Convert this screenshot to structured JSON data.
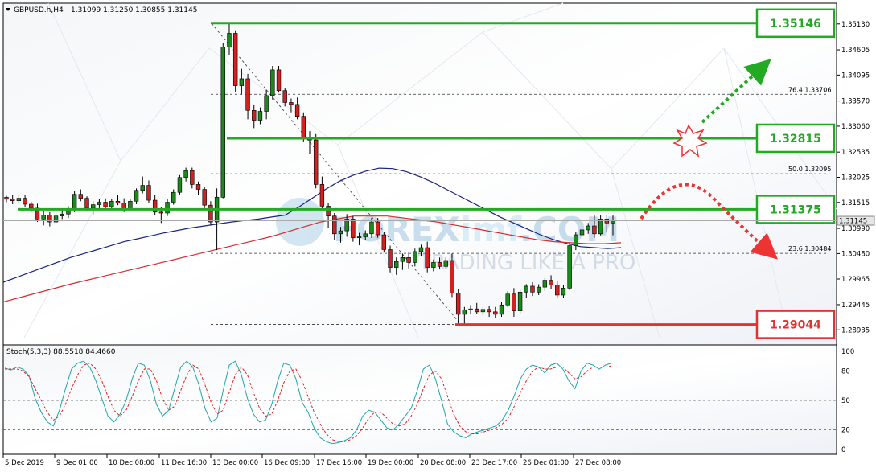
{
  "header": {
    "symbol": "GBPUSD.h,H4",
    "ohlc": "1.31099 1.31250 1.30855 1.31145"
  },
  "chart_data": {
    "type": "candlestick",
    "symbol": "GBPUSD.h",
    "timeframe": "H4",
    "price_axis": {
      "ticks": [
        "1.35130",
        "1.34605",
        "1.34095",
        "1.33570",
        "1.33060",
        "1.32535",
        "1.32025",
        "1.31515",
        "1.30990",
        "1.30480",
        "1.29965",
        "1.29445",
        "1.28935"
      ],
      "ylim": [
        1.2863,
        1.3555
      ]
    },
    "current_price": "1.31145",
    "time_axis": [
      "5 Dec 2019",
      "9 Dec 01:00",
      "10 Dec 08:00",
      "11 Dec 16:00",
      "13 Dec 00:00",
      "16 Dec 09:00",
      "17 Dec 16:00",
      "19 Dec 00:00",
      "20 Dec 08:00",
      "23 Dec 17:00",
      "26 Dec 01:00",
      "27 Dec 08:00"
    ],
    "levels": [
      {
        "label": "1.35146",
        "price": 1.35146,
        "color": "#22aa22"
      },
      {
        "label": "1.32815",
        "price": 1.32815,
        "color": "#22aa22"
      },
      {
        "label": "1.31375",
        "price": 1.31375,
        "color": "#22aa22"
      },
      {
        "label": "1.29044",
        "price": 1.29044,
        "color": "#e23333"
      }
    ],
    "fibonacci": [
      {
        "level": "76.4",
        "price": "1.33706"
      },
      {
        "level": "50.0",
        "price": "1.32095"
      },
      {
        "level": "23.6",
        "price": "1.30484"
      }
    ],
    "candles": [
      [
        1.3162,
        1.3165,
        1.3152,
        1.3158
      ],
      [
        1.3158,
        1.3167,
        1.3148,
        1.3155
      ],
      [
        1.3155,
        1.3166,
        1.3149,
        1.316
      ],
      [
        1.316,
        1.3166,
        1.3142,
        1.3148
      ],
      [
        1.3148,
        1.3153,
        1.3132,
        1.314
      ],
      [
        1.314,
        1.3149,
        1.3112,
        1.3118
      ],
      [
        1.3118,
        1.3135,
        1.3105,
        1.3126
      ],
      [
        1.3126,
        1.3132,
        1.3103,
        1.3112
      ],
      [
        1.3112,
        1.313,
        1.311,
        1.3124
      ],
      [
        1.3124,
        1.3136,
        1.3118,
        1.3128
      ],
      [
        1.3128,
        1.3144,
        1.312,
        1.3138
      ],
      [
        1.3138,
        1.3174,
        1.3132,
        1.3168
      ],
      [
        1.3168,
        1.3178,
        1.3154,
        1.316
      ],
      [
        1.316,
        1.3164,
        1.3135,
        1.314
      ],
      [
        1.314,
        1.3154,
        1.3126,
        1.3147
      ],
      [
        1.3147,
        1.3158,
        1.314,
        1.3152
      ],
      [
        1.3152,
        1.316,
        1.3136,
        1.3143
      ],
      [
        1.3143,
        1.3159,
        1.3138,
        1.3154
      ],
      [
        1.3154,
        1.3166,
        1.3146,
        1.315
      ],
      [
        1.315,
        1.316,
        1.3132,
        1.3138
      ],
      [
        1.3138,
        1.3158,
        1.3134,
        1.3154
      ],
      [
        1.3154,
        1.318,
        1.3148,
        1.3176
      ],
      [
        1.3176,
        1.3204,
        1.317,
        1.3186
      ],
      [
        1.3186,
        1.3196,
        1.315,
        1.3156
      ],
      [
        1.3156,
        1.3166,
        1.3126,
        1.3132
      ],
      [
        1.3132,
        1.3142,
        1.311,
        1.313
      ],
      [
        1.313,
        1.3158,
        1.3124,
        1.3152
      ],
      [
        1.3152,
        1.3178,
        1.3147,
        1.3172
      ],
      [
        1.3172,
        1.3207,
        1.3166,
        1.3202
      ],
      [
        1.3202,
        1.3222,
        1.3194,
        1.3216
      ],
      [
        1.3216,
        1.3222,
        1.318,
        1.3188
      ],
      [
        1.3188,
        1.3194,
        1.3166,
        1.3178
      ],
      [
        1.3178,
        1.3182,
        1.314,
        1.3146
      ],
      [
        1.3146,
        1.3154,
        1.3106,
        1.3112
      ],
      [
        1.3112,
        1.318,
        1.3055,
        1.3162
      ],
      [
        1.3162,
        1.3475,
        1.316,
        1.3466
      ],
      [
        1.3466,
        1.3514,
        1.345,
        1.3494
      ],
      [
        1.3494,
        1.35,
        1.3376,
        1.3388
      ],
      [
        1.3388,
        1.3422,
        1.337,
        1.3402
      ],
      [
        1.3402,
        1.3412,
        1.332,
        1.3338
      ],
      [
        1.3338,
        1.335,
        1.3302,
        1.3318
      ],
      [
        1.3318,
        1.3344,
        1.331,
        1.3336
      ],
      [
        1.3336,
        1.338,
        1.332,
        1.3368
      ],
      [
        1.3368,
        1.3428,
        1.336,
        1.342
      ],
      [
        1.342,
        1.3428,
        1.3374,
        1.3378
      ],
      [
        1.3378,
        1.3384,
        1.3346,
        1.3354
      ],
      [
        1.3354,
        1.3362,
        1.3334,
        1.335
      ],
      [
        1.335,
        1.3364,
        1.332,
        1.3326
      ],
      [
        1.3326,
        1.3334,
        1.3275,
        1.3284
      ],
      [
        1.3284,
        1.3296,
        1.325,
        1.3278
      ],
      [
        1.3278,
        1.329,
        1.318,
        1.3188
      ],
      [
        1.3188,
        1.3204,
        1.3138,
        1.3144
      ],
      [
        1.3144,
        1.315,
        1.31,
        1.3124
      ],
      [
        1.3124,
        1.313,
        1.3075,
        1.3088
      ],
      [
        1.3088,
        1.3102,
        1.307,
        1.3094
      ],
      [
        1.3094,
        1.3128,
        1.3082,
        1.3118
      ],
      [
        1.3118,
        1.3124,
        1.3072,
        1.308
      ],
      [
        1.308,
        1.309,
        1.3065,
        1.3082
      ],
      [
        1.3082,
        1.3095,
        1.3075,
        1.3088
      ],
      [
        1.3088,
        1.312,
        1.308,
        1.3112
      ],
      [
        1.3112,
        1.312,
        1.308,
        1.3086
      ],
      [
        1.3086,
        1.3092,
        1.305,
        1.3056
      ],
      [
        1.3056,
        1.3064,
        1.301,
        1.302
      ],
      [
        1.302,
        1.304,
        1.3005,
        1.3032
      ],
      [
        1.3032,
        1.3048,
        1.3015,
        1.304
      ],
      [
        1.304,
        1.305,
        1.3018,
        1.303
      ],
      [
        1.303,
        1.3058,
        1.3022,
        1.3052
      ],
      [
        1.3052,
        1.3066,
        1.3042,
        1.306
      ],
      [
        1.306,
        1.3072,
        1.301,
        1.302
      ],
      [
        1.302,
        1.3036,
        1.3012,
        1.303
      ],
      [
        1.303,
        1.304,
        1.3016,
        1.3022
      ],
      [
        1.3022,
        1.304,
        1.3018,
        1.3034
      ],
      [
        1.3034,
        1.3048,
        1.296,
        1.2968
      ],
      [
        1.2968,
        1.2976,
        1.2905,
        1.2925
      ],
      [
        1.2925,
        1.294,
        1.2906,
        1.2934
      ],
      [
        1.2934,
        1.2944,
        1.2925,
        1.2936
      ],
      [
        1.2936,
        1.2948,
        1.2926,
        1.293
      ],
      [
        1.293,
        1.294,
        1.2922,
        1.2935
      ],
      [
        1.2935,
        1.2942,
        1.292,
        1.293
      ],
      [
        1.293,
        1.294,
        1.2918,
        1.2925
      ],
      [
        1.2925,
        1.295,
        1.292,
        1.2944
      ],
      [
        1.2944,
        1.2972,
        1.294,
        1.2966
      ],
      [
        1.2966,
        1.2978,
        1.292,
        1.2932
      ],
      [
        1.2932,
        1.2976,
        1.2926,
        1.297
      ],
      [
        1.297,
        1.2986,
        1.2958,
        1.2982
      ],
      [
        1.2982,
        1.299,
        1.2962,
        1.297
      ],
      [
        1.297,
        1.2986,
        1.2964,
        1.298
      ],
      [
        1.298,
        1.2998,
        1.2972,
        1.2994
      ],
      [
        1.2994,
        1.3004,
        1.2976,
        1.2984
      ],
      [
        1.2984,
        1.2992,
        1.2958,
        1.2964
      ],
      [
        1.2964,
        1.2984,
        1.2958,
        1.2978
      ],
      [
        1.2978,
        1.307,
        1.2974,
        1.3064
      ],
      [
        1.3064,
        1.3092,
        1.3055,
        1.3086
      ],
      [
        1.3086,
        1.3102,
        1.308,
        1.3096
      ],
      [
        1.3096,
        1.311,
        1.3088,
        1.3104
      ],
      [
        1.3104,
        1.3125,
        1.308,
        1.3088
      ],
      [
        1.3088,
        1.3125,
        1.3085,
        1.3118
      ],
      [
        1.3118,
        1.3126,
        1.3092,
        1.311
      ],
      [
        1.311,
        1.3125,
        1.3085,
        1.3114
      ]
    ],
    "ma_blue": [
      1.299,
      1.3,
      1.301,
      1.302,
      1.303,
      1.304,
      1.3048,
      1.3056,
      1.3064,
      1.3072,
      1.3078,
      1.3084,
      1.309,
      1.3095,
      1.31,
      1.3104,
      1.3108,
      1.3112,
      1.3115,
      1.3118,
      1.3122,
      1.3126,
      1.3142,
      1.316,
      1.3178,
      1.3194,
      1.3206,
      1.3215,
      1.3221,
      1.322,
      1.3214,
      1.3204,
      1.3192,
      1.3178,
      1.3164,
      1.315,
      1.3136,
      1.3122,
      1.311,
      1.3098,
      1.3086,
      1.3076,
      1.3068,
      1.3062,
      1.306,
      1.3058,
      1.306
    ],
    "ma_red": [
      1.295,
      1.2959,
      1.2968,
      1.2977,
      1.2986,
      1.2994,
      1.3002,
      1.301,
      1.3018,
      1.3026,
      1.3034,
      1.3042,
      1.305,
      1.3058,
      1.3066,
      1.3074,
      1.3082,
      1.3092,
      1.3102,
      1.3112,
      1.3118,
      1.3124,
      1.3124,
      1.3124,
      1.312,
      1.3116,
      1.3112,
      1.3106,
      1.31,
      1.3094,
      1.3088,
      1.3082,
      1.3076,
      1.3072,
      1.307,
      1.3068,
      1.3068,
      1.307
    ],
    "stochastic": {
      "label": "Stoch(5,3,3) 88.5518 84.4660",
      "levels": [
        "100",
        "80",
        "50",
        "20",
        "0"
      ],
      "main": [
        83,
        81,
        84,
        82,
        75,
        52,
        38,
        28,
        24,
        40,
        62,
        82,
        88,
        90,
        84,
        70,
        52,
        34,
        28,
        36,
        50,
        72,
        88,
        86,
        70,
        46,
        34,
        40,
        62,
        84,
        90,
        84,
        66,
        42,
        28,
        32,
        60,
        86,
        90,
        76,
        52,
        36,
        28,
        30,
        46,
        70,
        88,
        86,
        72,
        48,
        38,
        22,
        12,
        8,
        6,
        7,
        9,
        12,
        20,
        34,
        40,
        38,
        30,
        22,
        20,
        26,
        34,
        42,
        60,
        82,
        86,
        72,
        50,
        26,
        18,
        14,
        12,
        16,
        18,
        20,
        22,
        24,
        30,
        40,
        55,
        72,
        82,
        86,
        84,
        78,
        86,
        88,
        82,
        70,
        62,
        80,
        88,
        86,
        82,
        86,
        88
      ],
      "signal": [
        82,
        82,
        82,
        80,
        74,
        62,
        50,
        38,
        30,
        34,
        46,
        62,
        76,
        86,
        88,
        82,
        70,
        54,
        40,
        34,
        40,
        54,
        70,
        82,
        82,
        70,
        52,
        40,
        44,
        60,
        76,
        86,
        82,
        66,
        48,
        36,
        40,
        58,
        76,
        84,
        76,
        58,
        42,
        34,
        36,
        50,
        68,
        80,
        82,
        70,
        54,
        38,
        26,
        16,
        10,
        8,
        8,
        10,
        14,
        22,
        32,
        38,
        38,
        32,
        26,
        24,
        26,
        34,
        46,
        62,
        76,
        80,
        72,
        54,
        36,
        24,
        18,
        16,
        16,
        18,
        20,
        22,
        26,
        32,
        44,
        58,
        70,
        80,
        84,
        82,
        82,
        84,
        84,
        78,
        72,
        74,
        80,
        84,
        84,
        84,
        85
      ]
    },
    "watermark": {
      "word1": "FOREX",
      "word2": "imf",
      "word3": ".COM",
      "tagline": "TRADING LIKE A PRO"
    }
  }
}
